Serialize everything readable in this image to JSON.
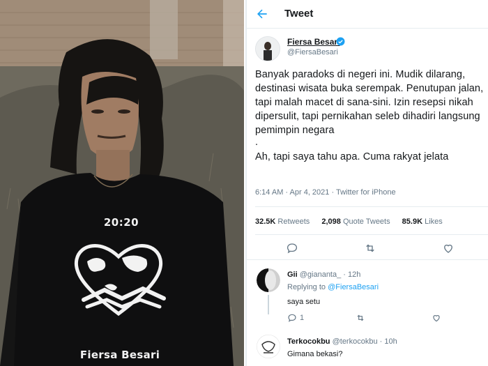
{
  "photo": {
    "shirt_clock": "20:20",
    "shirt_brand": "Fiersa Besari"
  },
  "header": {
    "title": "Tweet",
    "back_icon": "arrow-left-icon"
  },
  "author": {
    "name": "Fiersa Besari",
    "handle": "@FiersaBesari",
    "verified": true
  },
  "tweet": {
    "lines": [
      "Banyak paradoks di negeri ini. Mudik dilarang,",
      "destinasi wisata buka serempak. Penutupan jalan,",
      "tapi malah macet di sana-sini. Izin resepsi nikah",
      "dipersulit, tapi pernikahan seleb dihadiri langsung",
      "pemimpin negara"
    ],
    "dot": ".",
    "last_line": "Ah, tapi saya tahu apa. Cuma rakyat jelata",
    "timestamp": "6:14 AM · Apr 4, 2021 · Twitter for iPhone"
  },
  "stats": {
    "retweets_count": "32.5K",
    "retweets_label": "Retweets",
    "quotes_count": "2,098",
    "quotes_label": "Quote Tweets",
    "likes_count": "85.9K",
    "likes_label": "Likes"
  },
  "actions": [
    "reply-icon",
    "retweet-icon",
    "like-icon",
    "share-icon"
  ],
  "replies": [
    {
      "name": "Gii",
      "handle": "@giananta_ · 12h",
      "replying_prefix": "Replying to",
      "replying_to": "@FiersaBesari",
      "text": "saya setu",
      "reply_count": "1"
    },
    {
      "name": "Terkocokbu",
      "handle": "@terkocokbu · 10h",
      "text": "Gimana bekasi?"
    }
  ],
  "colors": {
    "accent": "#1da1f2",
    "text": "#14171a",
    "muted": "#657786",
    "divider": "#e6ecf0"
  }
}
